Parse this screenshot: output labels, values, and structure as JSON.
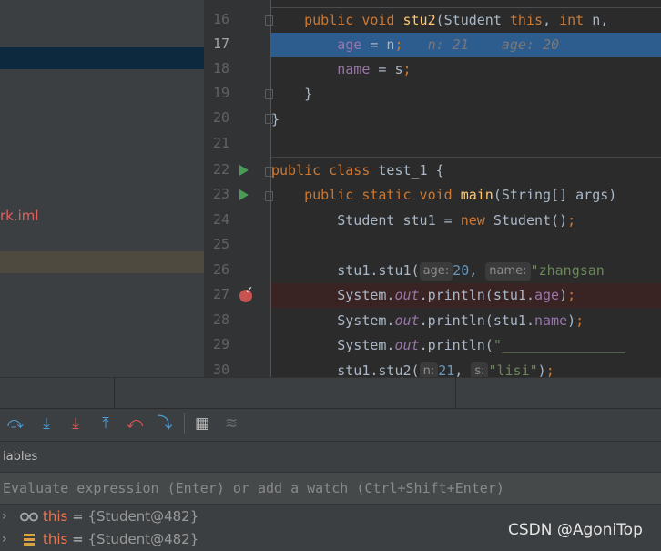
{
  "project": {
    "file_label": "rk.iml"
  },
  "editor": {
    "line_numbers": [
      "16",
      "17",
      "18",
      "19",
      "20",
      "21",
      "22",
      "23",
      "24",
      "25",
      "26",
      "27",
      "28",
      "29",
      "30"
    ],
    "lines": {
      "l16": {
        "t1": "public void ",
        "fn": "stu2",
        "t2": "(Student ",
        "kw1": "this",
        "t3": ", ",
        "kw2": "int",
        "t4": " n, "
      },
      "l17": {
        "fld": "age",
        "t1": " = n",
        "semi": ";",
        "hint": "   n: 21    age: 20"
      },
      "l18": {
        "fld": "name",
        "t1": " = s",
        "semi": ";"
      },
      "l19": {
        "t1": "}"
      },
      "l20": {
        "t1": "}"
      },
      "l22": {
        "kw1": "public class ",
        "t1": "test_1 {"
      },
      "l23": {
        "kw1": "public static void ",
        "fn": "main",
        "t1": "(String[] args)"
      },
      "l24": {
        "t1": "Student stu1 = ",
        "kw1": "new",
        "t2": " Student()",
        "semi": ";"
      },
      "l26": {
        "t1": "stu1.stu1(",
        "h1": "age:",
        "n1": "20",
        "t2": ", ",
        "h2": "name:",
        "s1": "\"zhangsan"
      },
      "l27": {
        "t1": "System.",
        "out": "out",
        "t2": ".println(stu1.",
        "fld": "age",
        "t3": ")",
        "semi": ";"
      },
      "l28": {
        "t1": "System.",
        "out": "out",
        "t2": ".println(stu1.",
        "fld": "name",
        "t3": ")",
        "semi": ";"
      },
      "l29": {
        "t1": "System.",
        "out": "out",
        "t2": ".println(",
        "s1": "\"_______________"
      },
      "l30": {
        "t1": "stu1.stu2(",
        "h1": "n:",
        "n1": "21",
        "t2": ", ",
        "h2": "s:",
        "s1": "\"lisi\"",
        "t3": ")",
        "semi": ";"
      }
    }
  },
  "toolbar": {
    "icons": [
      "show-execution-point-icon",
      "step-over-icon",
      "step-into-icon",
      "force-step-into-icon",
      "step-out-icon",
      "drop-frame-icon",
      "run-to-cursor-icon",
      "evaluate-expression-icon",
      "trace-icon"
    ],
    "glyphs": [
      "⤼",
      "⤓",
      "⤓",
      "⤒",
      "⤺",
      "⤵",
      "▦",
      "≋"
    ]
  },
  "variables": {
    "header": "iables",
    "eval_placeholder": "Evaluate expression (Enter) or add a watch (Ctrl+Shift+Enter)",
    "items": [
      {
        "name": "this",
        "eq": " = ",
        "value": "{Student@482}",
        "icon": "watch-glasses-icon"
      },
      {
        "name": "this",
        "eq": " = ",
        "value": "{Student@482}",
        "icon": "field-stack-icon"
      }
    ]
  },
  "watermark": "CSDN @AgoniTop",
  "colors": {
    "keyword": "#cc7832",
    "function": "#ffc66d",
    "field": "#9876aa",
    "number": "#6897bb",
    "string": "#6a8759",
    "exec_line": "#2d5c8f",
    "breakpoint": "#c75450"
  }
}
